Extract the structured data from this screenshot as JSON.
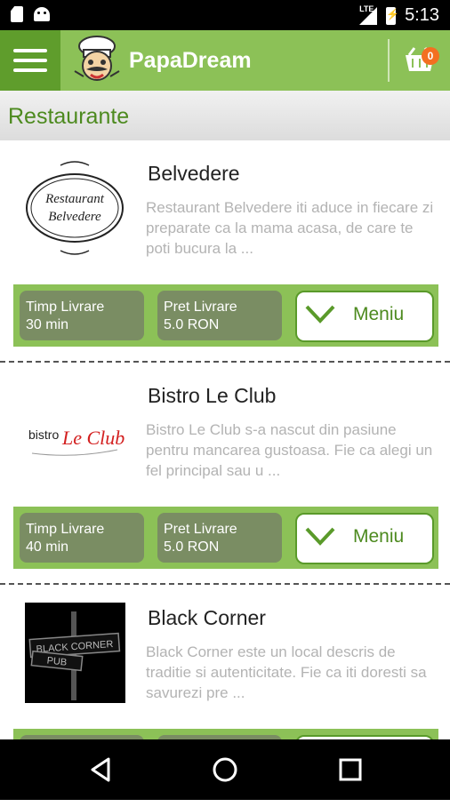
{
  "status_bar": {
    "network": "LTE",
    "time": "5:13"
  },
  "app_bar": {
    "title": "PapaDream",
    "cart_count": "0"
  },
  "section": {
    "title": "Restaurante"
  },
  "restaurants": [
    {
      "name": "Belvedere",
      "logo_text": [
        "Restaurant",
        "Belvedere"
      ],
      "description": "Restaurant Belvedere iti aduce in fiecare zi preparate ca la mama acasa, de care te poti bucura la  ...",
      "delivery_time_label": "Timp Livrare",
      "delivery_time": "30 min",
      "delivery_price_label": "Pret Livrare",
      "delivery_price": "5.0 RON",
      "menu_label": "Meniu"
    },
    {
      "name": "Bistro Le Club",
      "logo_text": [
        "bistro",
        "Le Club"
      ],
      "description": "Bistro Le Club s-a nascut din pasiune pentru mancarea gustoasa. Fie ca alegi un fel principal sau u ...",
      "delivery_time_label": "Timp Livrare",
      "delivery_time": "40 min",
      "delivery_price_label": "Pret Livrare",
      "delivery_price": "5.0 RON",
      "menu_label": "Meniu"
    },
    {
      "name": "Black Corner",
      "logo_text": [
        "BLACK CORNER",
        "PUB"
      ],
      "description": "Black Corner este un local descris de traditie si autenticitate. Fie ca iti doresti sa savurezi pre ...",
      "delivery_time_label": "",
      "delivery_time": "",
      "delivery_price_label": "",
      "delivery_price": "",
      "menu_label": ""
    }
  ],
  "colors": {
    "primary": "#8cc157",
    "primary_dark": "#5f9d2c",
    "text_green": "#4d8a1f",
    "chip": "#7a8d63",
    "badge": "#f36f21"
  }
}
